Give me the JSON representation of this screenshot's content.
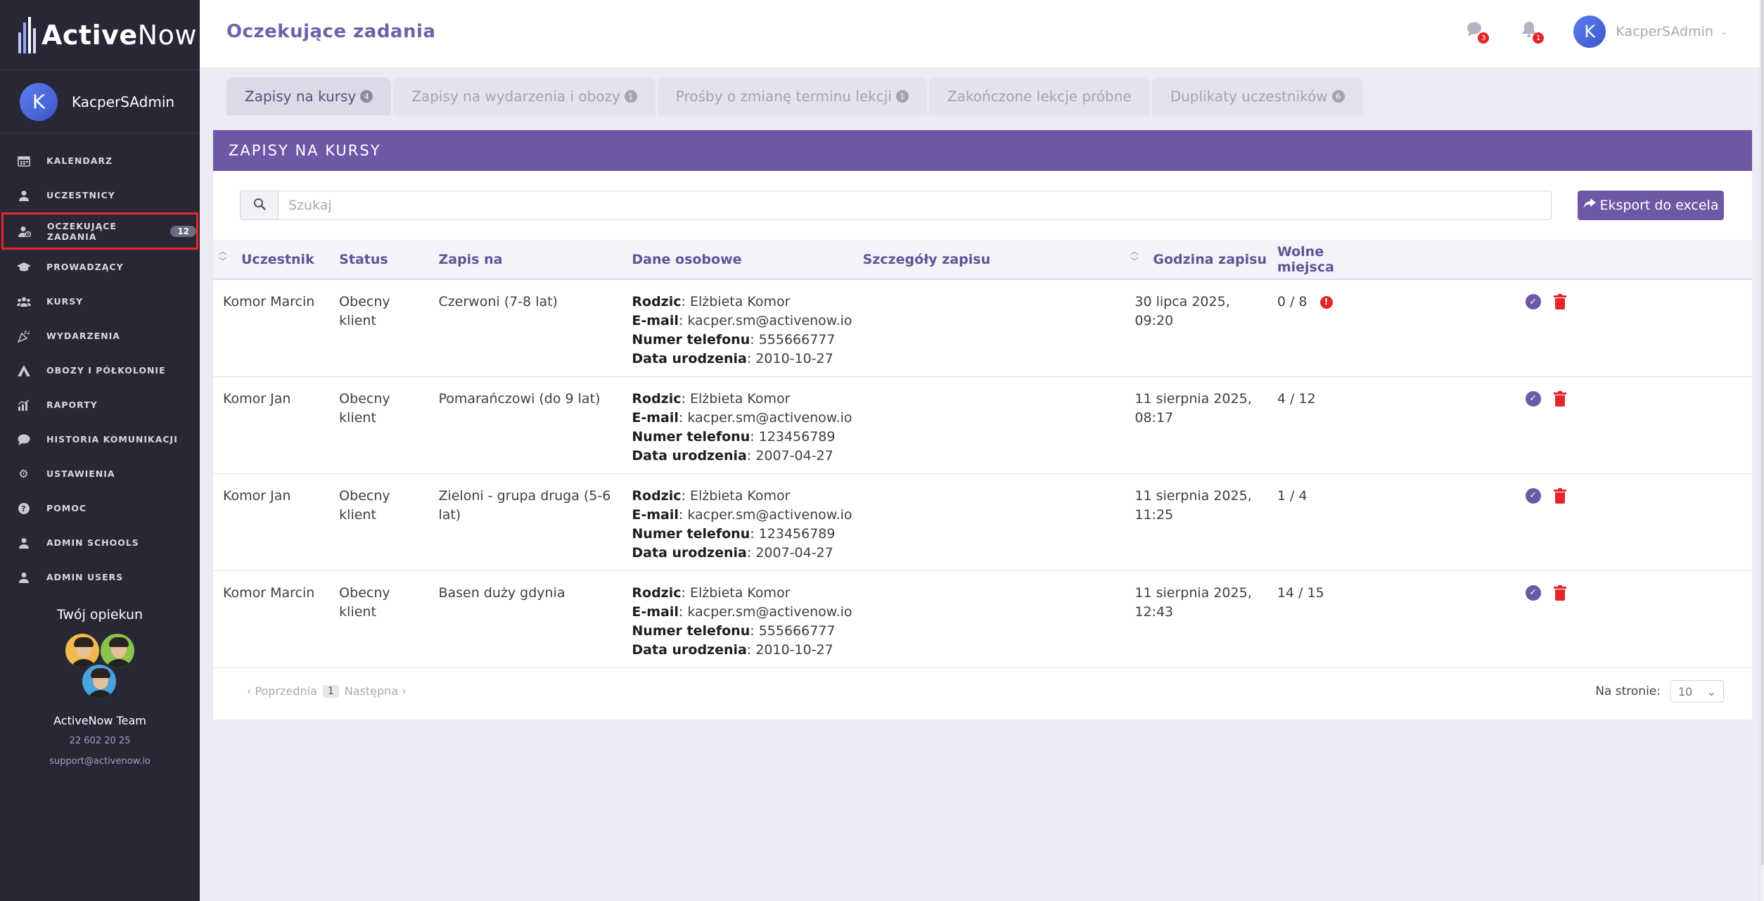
{
  "brand": {
    "name_bold": "Active",
    "name_light": "Now"
  },
  "sidebar": {
    "user_initial": "K",
    "user_name": "KacperSAdmin",
    "items": [
      {
        "label": "KALENDARZ",
        "icon": "calendar-icon"
      },
      {
        "label": "UCZESTNICY",
        "icon": "user-icon"
      },
      {
        "label": "OCZEKUJĄCE ZADANIA",
        "icon": "user-clock-icon",
        "badge": "12"
      },
      {
        "label": "PROWADZĄCY",
        "icon": "graduation-cap-icon"
      },
      {
        "label": "KURSY",
        "icon": "users-icon"
      },
      {
        "label": "WYDARZENIA",
        "icon": "party-icon"
      },
      {
        "label": "OBOZY I PÓŁKOLONIE",
        "icon": "tent-icon"
      },
      {
        "label": "RAPORTY",
        "icon": "chart-icon"
      },
      {
        "label": "HISTORIA KOMUNIKACJI",
        "icon": "chat-icon"
      },
      {
        "label": "USTAWIENIA",
        "icon": "gear-icon"
      },
      {
        "label": "POMOC",
        "icon": "help-icon"
      },
      {
        "label": "ADMIN SCHOOLS",
        "icon": "user-icon"
      },
      {
        "label": "ADMIN USERS",
        "icon": "user-icon"
      }
    ],
    "guardian": {
      "title": "Twój opiekun",
      "team": "ActiveNow Team",
      "phone": "22 602 20 25",
      "email": "support@activenow.io"
    }
  },
  "header": {
    "title": "Oczekujące zadania",
    "messages_count": "3",
    "notifications_count": "1",
    "user_initial": "K",
    "user_name": "KacperSAdmin"
  },
  "tabs": [
    {
      "label": "Zapisy na kursy",
      "count": "4"
    },
    {
      "label": "Zapisy na wydarzenia i obozy",
      "count": "1"
    },
    {
      "label": "Prośby o zmianę terminu lekcji",
      "count": "1"
    },
    {
      "label": "Zakończone lekcje próbne",
      "count": ""
    },
    {
      "label": "Duplikaty uczestników",
      "count": "6"
    }
  ],
  "panel": {
    "title": "ZAPISY NA KURSY",
    "search_placeholder": "Szukaj",
    "export_label": "Eksport do excela",
    "columns": [
      "Uczestnik",
      "Status",
      "Zapis na",
      "Dane osobowe",
      "Szczegóły zapisu",
      "Godzina zapisu",
      "Wolne miejsca"
    ],
    "field_labels": {
      "parent": "Rodzic",
      "email": "E-mail",
      "phone": "Numer telefonu",
      "birth": "Data urodzenia"
    },
    "rows": [
      {
        "participant": "Komor Marcin",
        "status": "Obecny klient",
        "course": "Czerwoni (7-8 lat)",
        "parent": "Elżbieta Komor",
        "email": "kacper.sm@activenow.io",
        "phone": "555666777",
        "birth": "2010-10-27",
        "time": "30 lipca 2025, 09:20",
        "free": "0 / 8",
        "alert": "!"
      },
      {
        "participant": "Komor Jan",
        "status": "Obecny klient",
        "course": "Pomarańczowi (do 9 lat)",
        "parent": "Elżbieta Komor",
        "email": "kacper.sm@activenow.io",
        "phone": "123456789",
        "birth": "2007-04-27",
        "time": "11 sierpnia 2025, 08:17",
        "free": "4 / 12",
        "alert": ""
      },
      {
        "participant": "Komor Jan",
        "status": "Obecny klient",
        "course": "Zieloni - grupa druga (5-6 lat)",
        "parent": "Elżbieta Komor",
        "email": "kacper.sm@activenow.io",
        "phone": "123456789",
        "birth": "2007-04-27",
        "time": "11 sierpnia 2025, 11:25",
        "free": "1 / 4",
        "alert": ""
      },
      {
        "participant": "Komor Marcin",
        "status": "Obecny klient",
        "course": "Basen duży gdynia",
        "parent": "Elżbieta Komor",
        "email": "kacper.sm@activenow.io",
        "phone": "555666777",
        "birth": "2010-10-27",
        "time": "11 sierpnia 2025, 12:43",
        "free": "14 / 15",
        "alert": ""
      }
    ],
    "pager": {
      "prev": "‹ Poprzednia",
      "page": "1",
      "next": "Następna ›"
    },
    "per_page_label": "Na stronie:",
    "per_page_value": "10"
  }
}
